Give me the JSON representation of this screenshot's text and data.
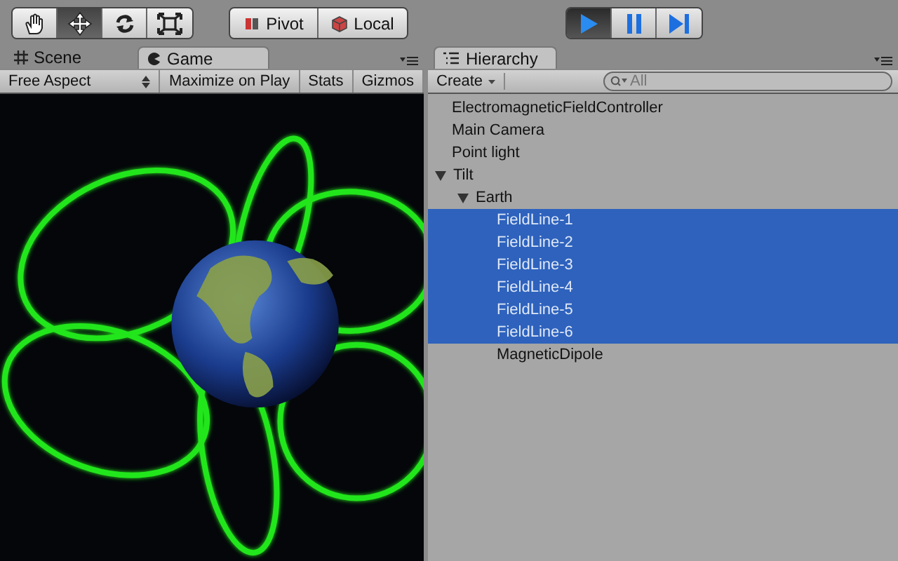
{
  "toolbar": {
    "tools": [
      {
        "kind": "hand",
        "selected": false
      },
      {
        "kind": "move",
        "selected": true
      },
      {
        "kind": "rotate",
        "selected": false
      },
      {
        "kind": "scale",
        "selected": false
      }
    ],
    "handle_buttons": [
      {
        "kind": "pivot",
        "label": "Pivot"
      },
      {
        "kind": "local",
        "label": "Local"
      }
    ],
    "playback": [
      {
        "kind": "play",
        "selected": true
      },
      {
        "kind": "pause",
        "selected": false
      },
      {
        "kind": "step",
        "selected": false
      }
    ]
  },
  "left_panel": {
    "tabs": [
      {
        "kind": "scene",
        "label": "Scene",
        "selected": false
      },
      {
        "kind": "game",
        "label": "Game",
        "selected": true
      }
    ],
    "aspect": "Free Aspect",
    "buttons": [
      "Maximize on Play",
      "Stats",
      "Gizmos"
    ]
  },
  "hierarchy": {
    "tab": {
      "label": "Hierarchy",
      "selected": true
    },
    "create": "Create",
    "search_placeholder": "All",
    "items": [
      {
        "label": "ElectromagneticFieldController",
        "selected": false
      },
      {
        "label": "Main Camera",
        "selected": false
      },
      {
        "label": "Point light",
        "selected": false
      },
      {
        "label": "Tilt",
        "selected": false,
        "expanded": true,
        "children": [
          {
            "label": "Earth",
            "selected": false,
            "expanded": true,
            "children": [
              {
                "label": "FieldLine-1",
                "selected": true
              },
              {
                "label": "FieldLine-2",
                "selected": true
              },
              {
                "label": "FieldLine-3",
                "selected": true
              },
              {
                "label": "FieldLine-4",
                "selected": true
              },
              {
                "label": "FieldLine-5",
                "selected": true
              },
              {
                "label": "FieldLine-6",
                "selected": true
              },
              {
                "label": "MagneticDipole",
                "selected": false
              }
            ]
          }
        ]
      }
    ]
  }
}
